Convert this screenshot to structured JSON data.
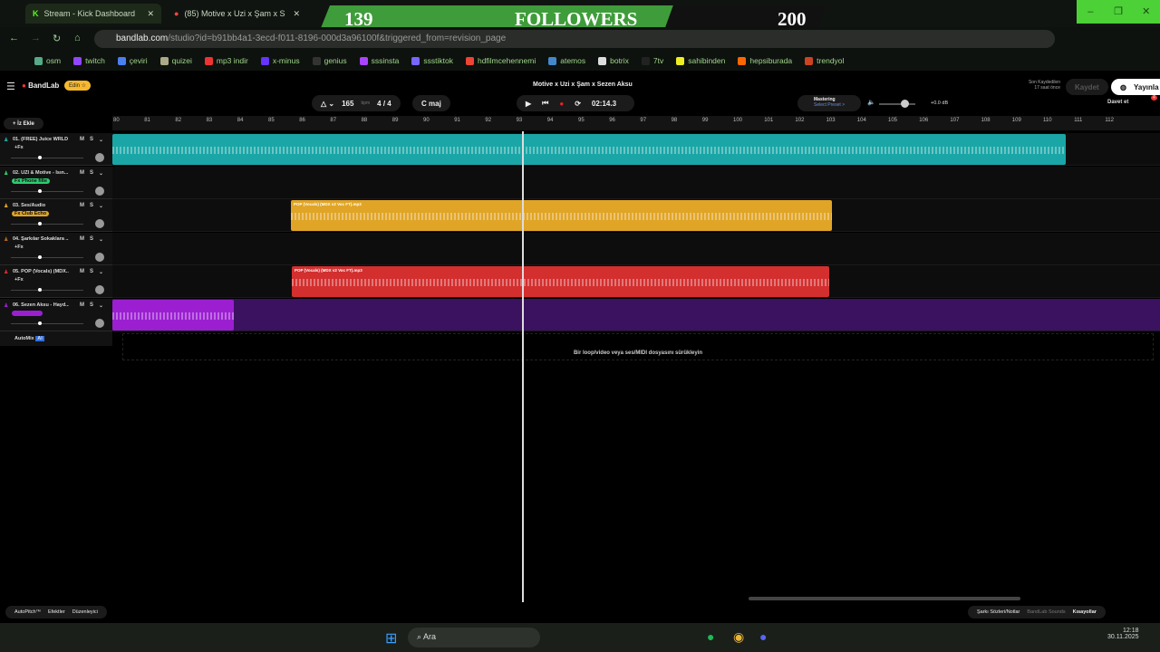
{
  "browser": {
    "tabs": [
      {
        "label": "Stream - Kick Dashboard"
      },
      {
        "label": "(85) Motive x Uzi x Şam x S"
      }
    ],
    "url_host": "bandlab.com",
    "url_path": "/studio?id=b91bb4a1-3ecd-f011-8196-000d3a96100f&triggered_from=revision_page",
    "bookmarks": [
      "osm",
      "twitch",
      "çeviri",
      "quizei",
      "mp3 indir",
      "x-minus",
      "genius",
      "sssinsta",
      "ssstiktok",
      "hdfilmcehennemi",
      "atemos",
      "botrix",
      "7tv",
      "sahibinden",
      "hepsiburada",
      "trendyol"
    ]
  },
  "overlay": {
    "current": "139",
    "label": "FOLLOWERS",
    "goal": "200"
  },
  "app": {
    "brand": "BandLab",
    "edit_badge": "Edin ☆",
    "project_title": "Motive x Uzi x Şam x Sezen Aksu",
    "last_saved_label": "Son Kaydedilen",
    "last_saved_time": "17 saat önce",
    "save_label": "Kaydet",
    "publish_label": "Yayınla",
    "invite_label": "Davet et",
    "tempo": "165",
    "tempo_unit": "bpm",
    "time_sig": "4 / 4",
    "key": "C maj",
    "time": "02:14.3",
    "mastering_label": "Mastering",
    "mastering_preset": "Select Preset >",
    "master_db": "+0.0 dB",
    "notif_count": "4",
    "add_track": "+ İz Ekle",
    "automix": "AutoMix",
    "ai": "AI",
    "drop_hint": "Bir loop/video veya ses/MIDI dosyasını sürükleyin",
    "ruler": [
      "80",
      "81",
      "82",
      "83",
      "84",
      "85",
      "86",
      "87",
      "88",
      "89",
      "90",
      "91",
      "92",
      "93",
      "94",
      "95",
      "96",
      "97",
      "98",
      "99",
      "100",
      "101",
      "102",
      "103",
      "104",
      "105",
      "106",
      "107",
      "108",
      "109",
      "110",
      "111",
      "112"
    ],
    "tracks": [
      {
        "name": "01. (FREE) Juice WRLD ...",
        "fx": "+Fx",
        "color": "#1aa6a6"
      },
      {
        "name": "02. UZI & Motive - Isın...",
        "fx": "Fx Phone filte",
        "color": "#2ecc71"
      },
      {
        "name": "03. Ses/Audio",
        "fx": "Fx Club Echo",
        "color": "#e0a526",
        "clip": "POP (Vocals) (MDX v2 Voc FT).mp3"
      },
      {
        "name": "04. Şarkılar Sokaklara ...",
        "fx": "+Fx",
        "color": "#b5651d"
      },
      {
        "name": "05. POP (Vocals) (MDX...",
        "fx": "+Fx",
        "color": "#d32f2f",
        "clip": "POP (Vocals) (MDX v2 Voc FT).mp3"
      },
      {
        "name": "06. Sezen Aksu - Hayd...",
        "fx": "",
        "color": "#9b1fd1"
      }
    ],
    "footer": {
      "autopitch": "AutoPitch™",
      "effects": "Efektler",
      "editor": "Düzenleyici",
      "lyrics": "Şarkı Sözleri/Notlar",
      "sounds": "BandLab Sounds",
      "shortcuts": "Kısayollar"
    }
  },
  "taskbar": {
    "search": "Ara",
    "time": "12:18",
    "date": "30.11.2025"
  }
}
